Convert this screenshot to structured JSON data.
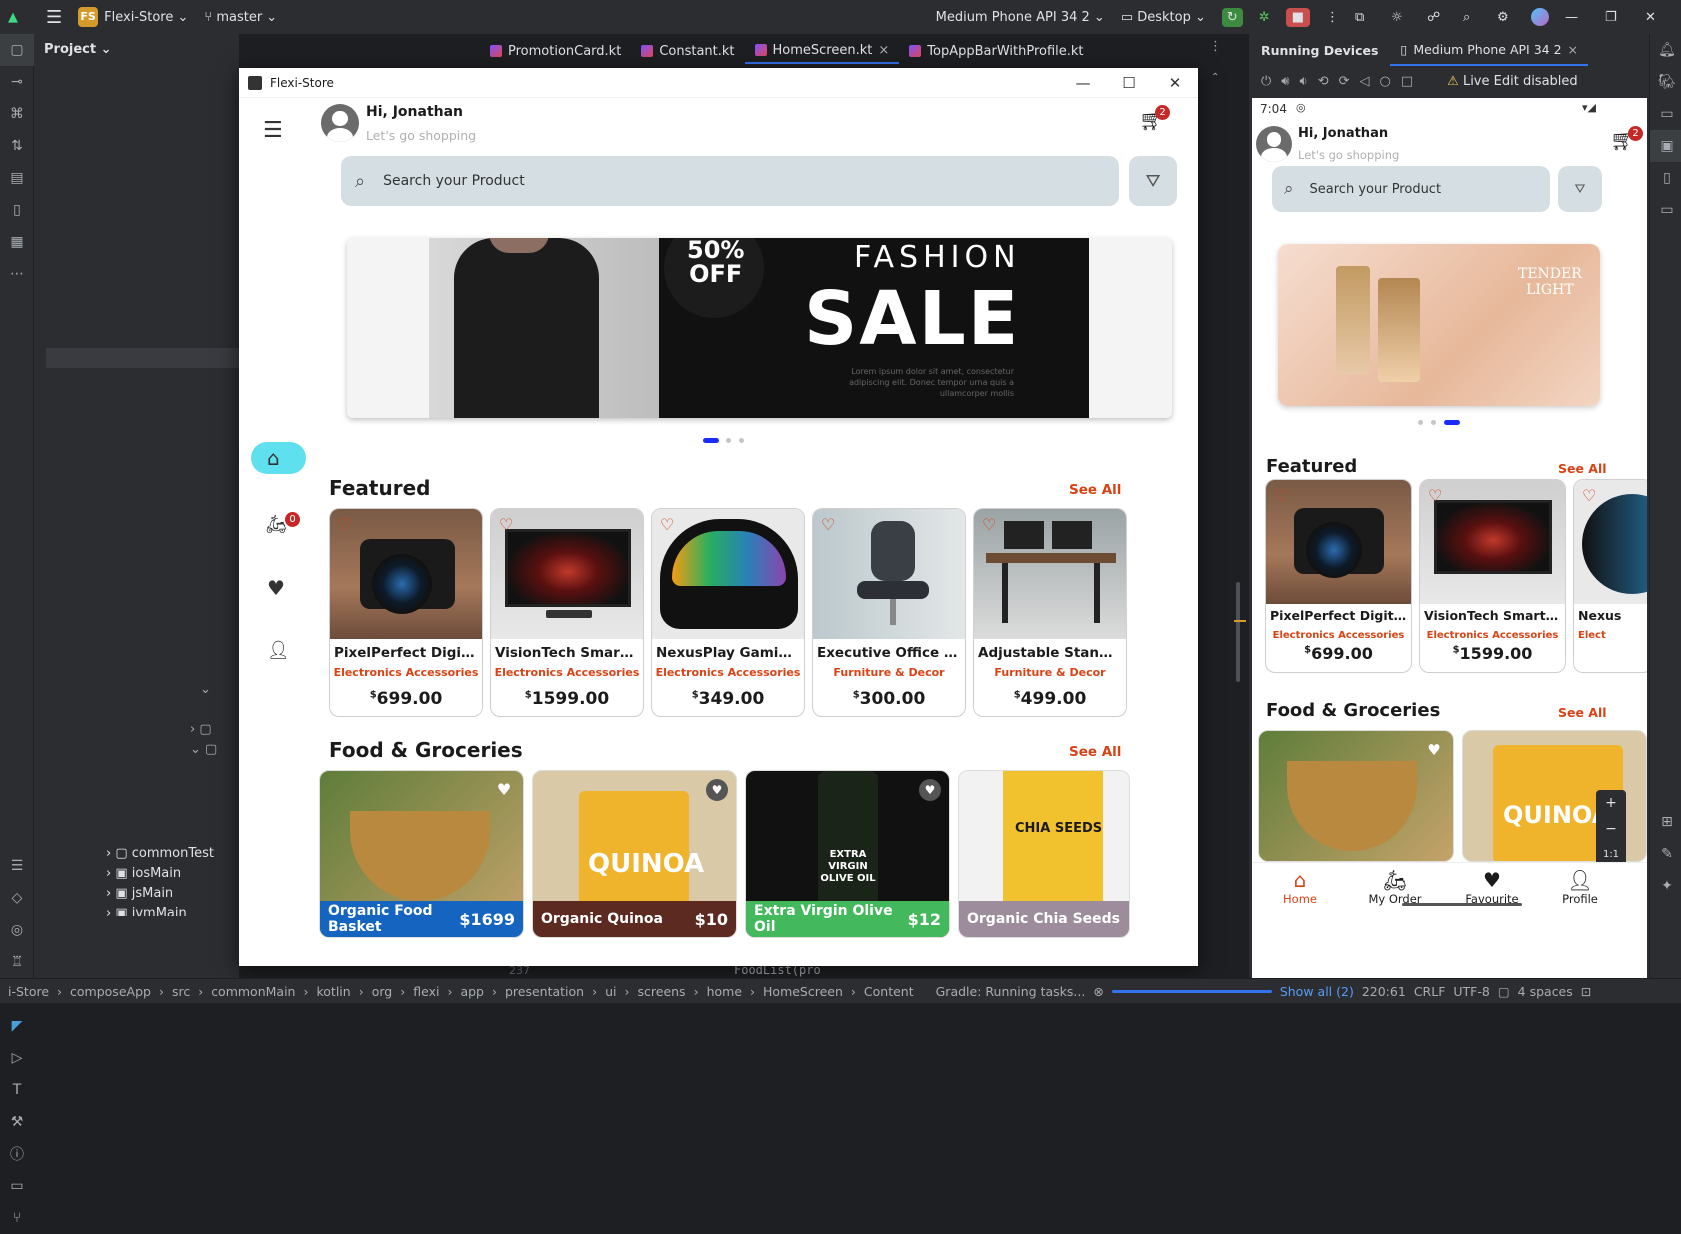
{
  "ide": {
    "project_badge": "FS",
    "project_name": "Flexi-Store",
    "branch": "master",
    "device_selector": "Medium Phone API 34 2",
    "run_config": "Desktop",
    "project_panel_label": "Project",
    "tabs": [
      "PromotionCard.kt",
      "Constant.kt",
      "HomeScreen.kt",
      "TopAppBarWithProfile.kt"
    ],
    "active_tab": "HomeScreen.kt",
    "tree": [
      "commonTest",
      "iosMain",
      "jsMain",
      "jvmMain"
    ],
    "running_devices_label": "Running Devices",
    "running_device_tab": "Medium Phone API 34 2",
    "live_edit": "Live Edit disabled",
    "code_line": "FoodList(pro",
    "line_number": "237"
  },
  "status_bar": {
    "breadcrumb": [
      "i-Store",
      "composeApp",
      "src",
      "commonMain",
      "kotlin",
      "org",
      "flexi",
      "app",
      "presentation",
      "ui",
      "screens",
      "home",
      "HomeScreen",
      "Content"
    ],
    "task": "Gradle: Running tasks...",
    "show_all": "Show all (2)",
    "position": "220:61",
    "line_sep": "CRLF",
    "encoding": "UTF-8",
    "indent": "4 spaces"
  },
  "window": {
    "title": "Flexi-Store"
  },
  "app": {
    "greeting": "Hi, Jonathan",
    "subtitle": "Let's go shopping",
    "cart_count": "2",
    "order_count": "0",
    "search_placeholder": "Search your Product",
    "banner": {
      "discount_top": "50%",
      "discount_bottom": "OFF",
      "title_small": "FASHION",
      "title_big": "SALE",
      "body": "Lorem ipsum dolor sit amet, consectetur adipiscing elit. Donec tempor urna quis a ullamcorper mollis"
    },
    "phone_banner": {
      "line1": "TENDER",
      "line2": "LIGHT"
    },
    "featured_title": "Featured",
    "food_title": "Food & Groceries",
    "see_all": "See All",
    "featured": [
      {
        "name": "PixelPerfect Digital C...",
        "category": "Electronics Accessories",
        "price": "699.00",
        "currency": "$"
      },
      {
        "name": "VisionTech SmartTV ...",
        "category": "Electronics Accessories",
        "price": "1599.00",
        "currency": "$"
      },
      {
        "name": "NexusPlay Gaming C...",
        "category": "Electronics Accessories",
        "price": "349.00",
        "currency": "$"
      },
      {
        "name": "Executive Office Chair",
        "category": "Furniture & Decor",
        "price": "300.00",
        "currency": "$"
      },
      {
        "name": "Adjustable Standing ...",
        "category": "Furniture & Decor",
        "price": "499.00",
        "currency": "$"
      }
    ],
    "food": [
      {
        "name": "Organic Food Basket",
        "price": "$1699",
        "color": "#1565c0"
      },
      {
        "name": "Organic Quinoa",
        "price": "$10",
        "color": "#5d2a22"
      },
      {
        "name": "Extra Virgin Olive Oil",
        "price": "$12",
        "color": "#43b85c"
      },
      {
        "name": "Organic Chia Seeds",
        "price": "",
        "color": "#9c8c9c"
      }
    ],
    "food_labels": {
      "quinoa": "QUINOA",
      "olive": "EXTRA VIRGIN OLIVE OIL",
      "chia": "CHIA SEEDS"
    }
  },
  "phone": {
    "time": "7:04",
    "nav": [
      "Home",
      "My Order",
      "Favourite",
      "Profile"
    ],
    "featured_partial": "Nexus",
    "category_partial": "Elect",
    "zoom_label": "1:1"
  },
  "colors": {
    "accent": "#d84315",
    "search_bg": "#d5dfe3",
    "nav_active_bg": "#5ee0ef"
  }
}
